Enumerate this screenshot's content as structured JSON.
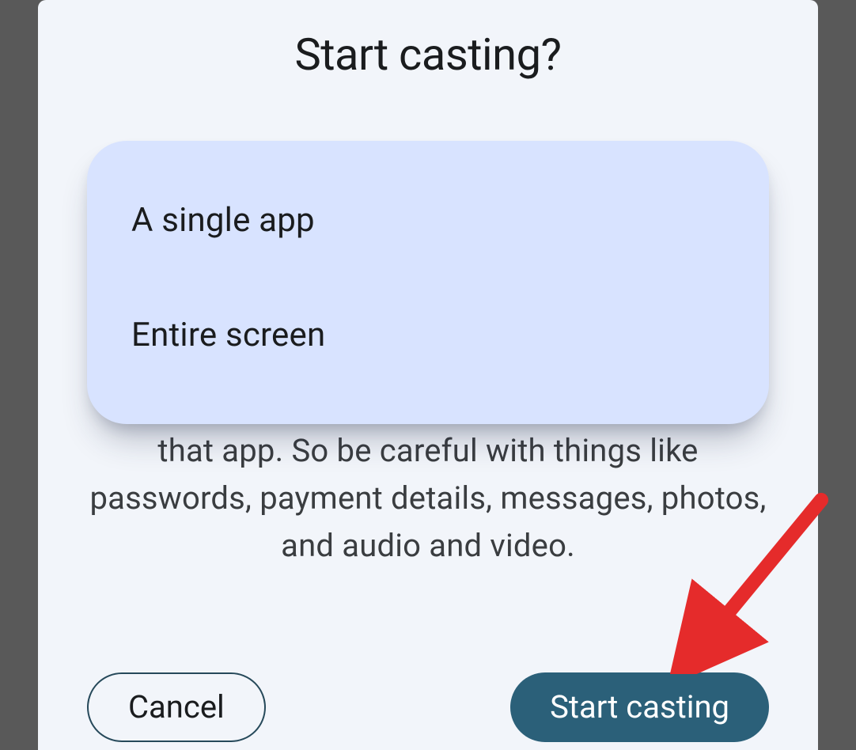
{
  "dialog": {
    "title": "Start casting?",
    "warning_text": "that app. So be careful with things like passwords, payment details, messages, photos, and audio and video.",
    "cancel_label": "Cancel",
    "start_label": "Start casting"
  },
  "menu": {
    "items": [
      {
        "label": "A single app"
      },
      {
        "label": "Entire screen"
      }
    ]
  },
  "annotation": {
    "arrow_color": "#e52b2b"
  }
}
